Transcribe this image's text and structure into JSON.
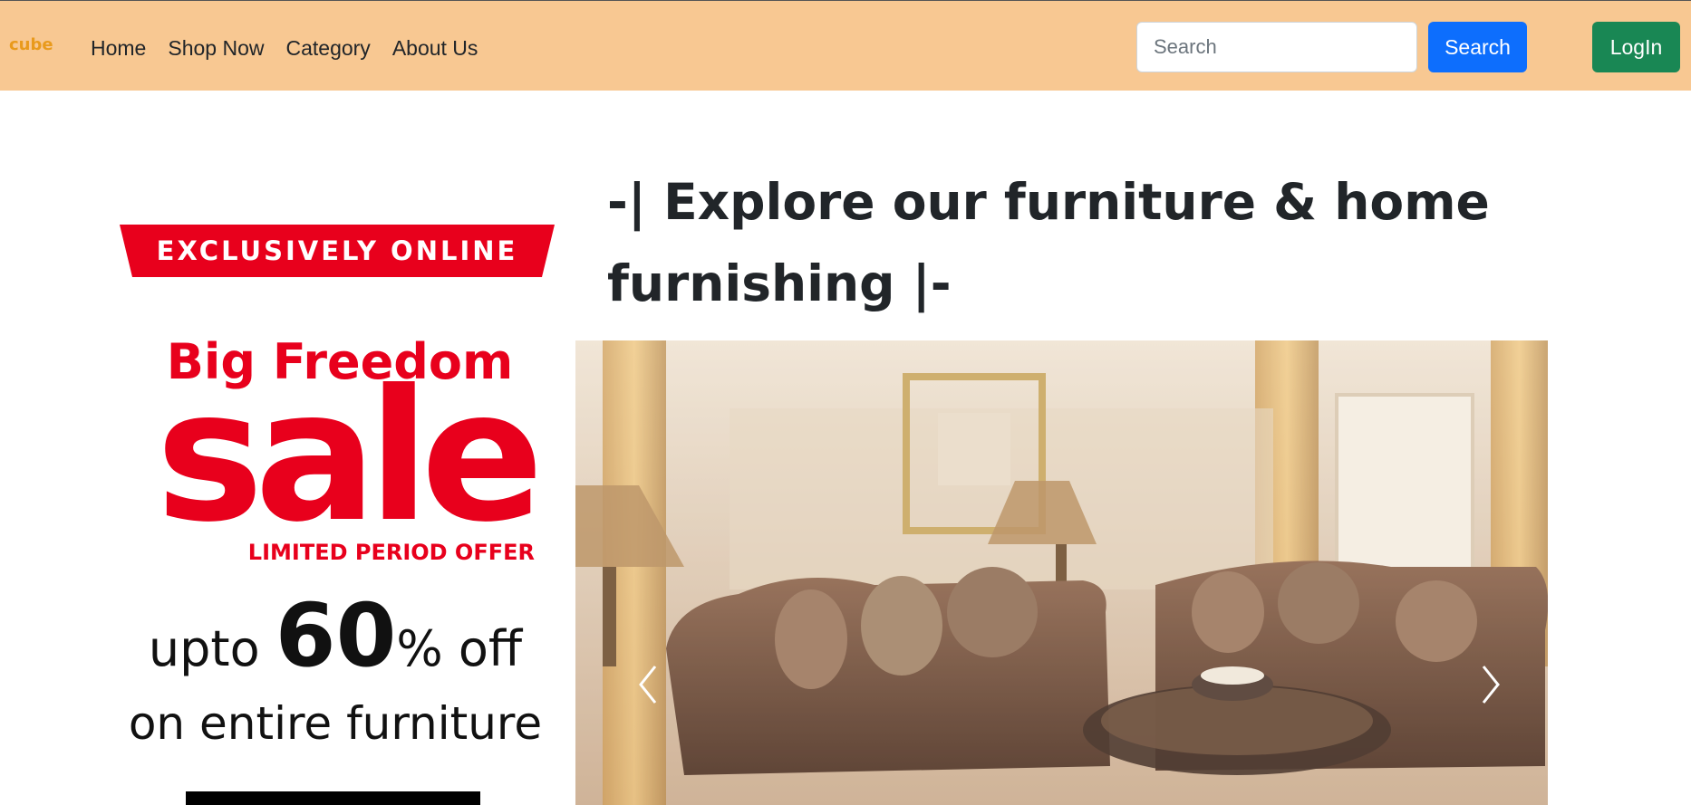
{
  "brand": {
    "logo_text": "cube"
  },
  "nav": {
    "links": [
      {
        "label": "Home"
      },
      {
        "label": "Shop Now"
      },
      {
        "label": "Category"
      },
      {
        "label": "About Us"
      }
    ]
  },
  "search": {
    "placeholder": "Search",
    "button_label": "Search"
  },
  "auth": {
    "login_label": "LogIn"
  },
  "promo": {
    "ribbon": "EXCLUSIVELY ONLINE",
    "headline": "Big Freedom",
    "sale": "sale",
    "limited": "LIMITED PERIOD OFFER",
    "offer_prefix": "upto",
    "offer_number": "60",
    "offer_suffix": "% off",
    "offer_line2": "on entire furniture"
  },
  "hero": {
    "heading": "-| Explore our furniture & home furnishing |-"
  },
  "colors": {
    "navbar_bg": "#f8c892",
    "search_btn": "#0d6efd",
    "login_btn": "#198754",
    "promo_red": "#e8001c"
  },
  "icons": {
    "prev": "chevron-left-icon",
    "next": "chevron-right-icon"
  }
}
